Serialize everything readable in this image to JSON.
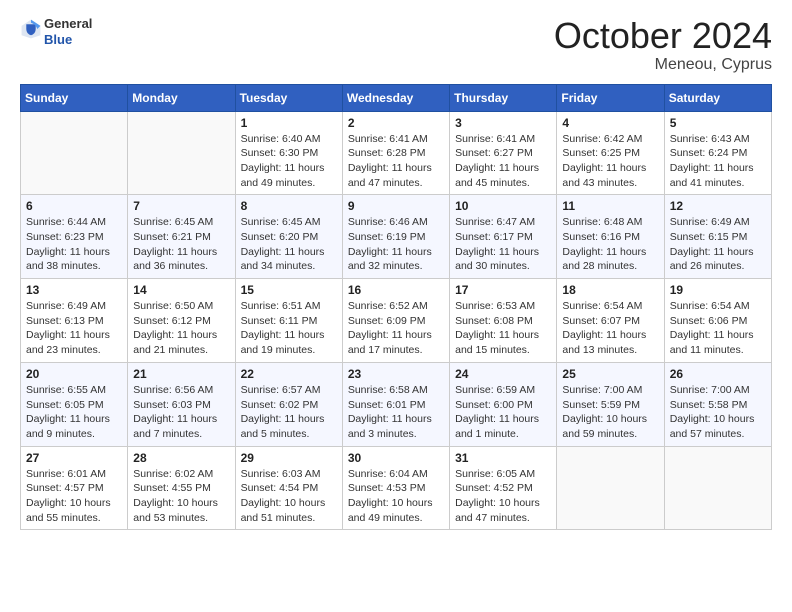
{
  "logo": {
    "general": "General",
    "blue": "Blue"
  },
  "title": "October 2024",
  "subtitle": "Meneou, Cyprus",
  "days_of_week": [
    "Sunday",
    "Monday",
    "Tuesday",
    "Wednesday",
    "Thursday",
    "Friday",
    "Saturday"
  ],
  "weeks": [
    [
      {
        "day": "",
        "sunrise": "",
        "sunset": "",
        "daylight": ""
      },
      {
        "day": "",
        "sunrise": "",
        "sunset": "",
        "daylight": ""
      },
      {
        "day": "1",
        "sunrise": "Sunrise: 6:40 AM",
        "sunset": "Sunset: 6:30 PM",
        "daylight": "Daylight: 11 hours and 49 minutes."
      },
      {
        "day": "2",
        "sunrise": "Sunrise: 6:41 AM",
        "sunset": "Sunset: 6:28 PM",
        "daylight": "Daylight: 11 hours and 47 minutes."
      },
      {
        "day": "3",
        "sunrise": "Sunrise: 6:41 AM",
        "sunset": "Sunset: 6:27 PM",
        "daylight": "Daylight: 11 hours and 45 minutes."
      },
      {
        "day": "4",
        "sunrise": "Sunrise: 6:42 AM",
        "sunset": "Sunset: 6:25 PM",
        "daylight": "Daylight: 11 hours and 43 minutes."
      },
      {
        "day": "5",
        "sunrise": "Sunrise: 6:43 AM",
        "sunset": "Sunset: 6:24 PM",
        "daylight": "Daylight: 11 hours and 41 minutes."
      }
    ],
    [
      {
        "day": "6",
        "sunrise": "Sunrise: 6:44 AM",
        "sunset": "Sunset: 6:23 PM",
        "daylight": "Daylight: 11 hours and 38 minutes."
      },
      {
        "day": "7",
        "sunrise": "Sunrise: 6:45 AM",
        "sunset": "Sunset: 6:21 PM",
        "daylight": "Daylight: 11 hours and 36 minutes."
      },
      {
        "day": "8",
        "sunrise": "Sunrise: 6:45 AM",
        "sunset": "Sunset: 6:20 PM",
        "daylight": "Daylight: 11 hours and 34 minutes."
      },
      {
        "day": "9",
        "sunrise": "Sunrise: 6:46 AM",
        "sunset": "Sunset: 6:19 PM",
        "daylight": "Daylight: 11 hours and 32 minutes."
      },
      {
        "day": "10",
        "sunrise": "Sunrise: 6:47 AM",
        "sunset": "Sunset: 6:17 PM",
        "daylight": "Daylight: 11 hours and 30 minutes."
      },
      {
        "day": "11",
        "sunrise": "Sunrise: 6:48 AM",
        "sunset": "Sunset: 6:16 PM",
        "daylight": "Daylight: 11 hours and 28 minutes."
      },
      {
        "day": "12",
        "sunrise": "Sunrise: 6:49 AM",
        "sunset": "Sunset: 6:15 PM",
        "daylight": "Daylight: 11 hours and 26 minutes."
      }
    ],
    [
      {
        "day": "13",
        "sunrise": "Sunrise: 6:49 AM",
        "sunset": "Sunset: 6:13 PM",
        "daylight": "Daylight: 11 hours and 23 minutes."
      },
      {
        "day": "14",
        "sunrise": "Sunrise: 6:50 AM",
        "sunset": "Sunset: 6:12 PM",
        "daylight": "Daylight: 11 hours and 21 minutes."
      },
      {
        "day": "15",
        "sunrise": "Sunrise: 6:51 AM",
        "sunset": "Sunset: 6:11 PM",
        "daylight": "Daylight: 11 hours and 19 minutes."
      },
      {
        "day": "16",
        "sunrise": "Sunrise: 6:52 AM",
        "sunset": "Sunset: 6:09 PM",
        "daylight": "Daylight: 11 hours and 17 minutes."
      },
      {
        "day": "17",
        "sunrise": "Sunrise: 6:53 AM",
        "sunset": "Sunset: 6:08 PM",
        "daylight": "Daylight: 11 hours and 15 minutes."
      },
      {
        "day": "18",
        "sunrise": "Sunrise: 6:54 AM",
        "sunset": "Sunset: 6:07 PM",
        "daylight": "Daylight: 11 hours and 13 minutes."
      },
      {
        "day": "19",
        "sunrise": "Sunrise: 6:54 AM",
        "sunset": "Sunset: 6:06 PM",
        "daylight": "Daylight: 11 hours and 11 minutes."
      }
    ],
    [
      {
        "day": "20",
        "sunrise": "Sunrise: 6:55 AM",
        "sunset": "Sunset: 6:05 PM",
        "daylight": "Daylight: 11 hours and 9 minutes."
      },
      {
        "day": "21",
        "sunrise": "Sunrise: 6:56 AM",
        "sunset": "Sunset: 6:03 PM",
        "daylight": "Daylight: 11 hours and 7 minutes."
      },
      {
        "day": "22",
        "sunrise": "Sunrise: 6:57 AM",
        "sunset": "Sunset: 6:02 PM",
        "daylight": "Daylight: 11 hours and 5 minutes."
      },
      {
        "day": "23",
        "sunrise": "Sunrise: 6:58 AM",
        "sunset": "Sunset: 6:01 PM",
        "daylight": "Daylight: 11 hours and 3 minutes."
      },
      {
        "day": "24",
        "sunrise": "Sunrise: 6:59 AM",
        "sunset": "Sunset: 6:00 PM",
        "daylight": "Daylight: 11 hours and 1 minute."
      },
      {
        "day": "25",
        "sunrise": "Sunrise: 7:00 AM",
        "sunset": "Sunset: 5:59 PM",
        "daylight": "Daylight: 10 hours and 59 minutes."
      },
      {
        "day": "26",
        "sunrise": "Sunrise: 7:00 AM",
        "sunset": "Sunset: 5:58 PM",
        "daylight": "Daylight: 10 hours and 57 minutes."
      }
    ],
    [
      {
        "day": "27",
        "sunrise": "Sunrise: 6:01 AM",
        "sunset": "Sunset: 4:57 PM",
        "daylight": "Daylight: 10 hours and 55 minutes."
      },
      {
        "day": "28",
        "sunrise": "Sunrise: 6:02 AM",
        "sunset": "Sunset: 4:55 PM",
        "daylight": "Daylight: 10 hours and 53 minutes."
      },
      {
        "day": "29",
        "sunrise": "Sunrise: 6:03 AM",
        "sunset": "Sunset: 4:54 PM",
        "daylight": "Daylight: 10 hours and 51 minutes."
      },
      {
        "day": "30",
        "sunrise": "Sunrise: 6:04 AM",
        "sunset": "Sunset: 4:53 PM",
        "daylight": "Daylight: 10 hours and 49 minutes."
      },
      {
        "day": "31",
        "sunrise": "Sunrise: 6:05 AM",
        "sunset": "Sunset: 4:52 PM",
        "daylight": "Daylight: 10 hours and 47 minutes."
      },
      {
        "day": "",
        "sunrise": "",
        "sunset": "",
        "daylight": ""
      },
      {
        "day": "",
        "sunrise": "",
        "sunset": "",
        "daylight": ""
      }
    ]
  ]
}
